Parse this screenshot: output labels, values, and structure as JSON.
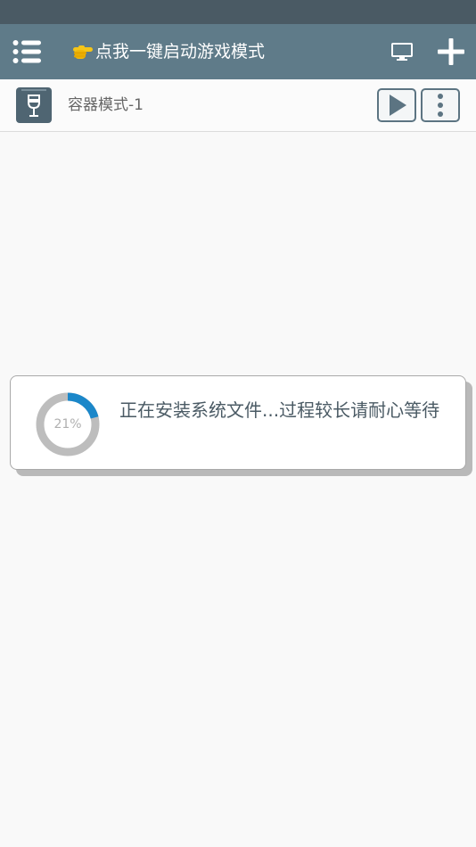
{
  "toolbar": {
    "title": "点我一键启动游戏模式",
    "menu_icon": "list-menu-icon",
    "hand_icon": "pointing-hand-emoji",
    "monitor_icon": "monitor-icon",
    "add_icon": "plus-icon",
    "background": "#5f7b89"
  },
  "container": {
    "name": "容器模式-1",
    "icon": "wine-glass-box-icon",
    "play_icon": "play-icon",
    "more_icon": "more-vertical-icon"
  },
  "dialog": {
    "progress_percent": 21,
    "progress_label": "21%",
    "message": "正在安装系统文件...过程较长请耐心等待",
    "accent": "#1b87c9"
  }
}
